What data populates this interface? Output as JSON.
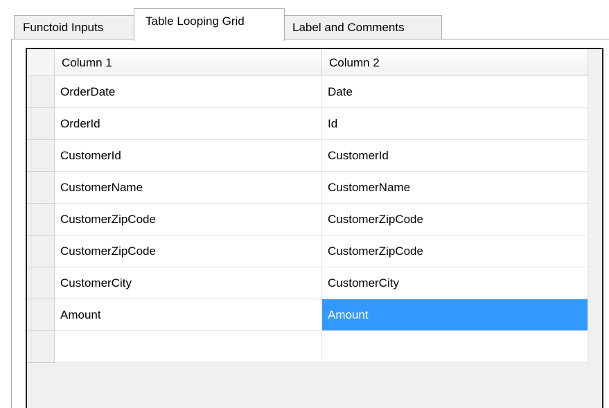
{
  "tabs": [
    {
      "label": "Functoid Inputs",
      "selected": false
    },
    {
      "label": "Table Looping Grid",
      "selected": true
    },
    {
      "label": "Label and Comments",
      "selected": false
    }
  ],
  "grid": {
    "columns": [
      "Column 1",
      "Column 2"
    ],
    "rows": [
      [
        "OrderDate",
        "Date"
      ],
      [
        "OrderId",
        "Id"
      ],
      [
        "CustomerId",
        "CustomerId"
      ],
      [
        "CustomerName",
        "CustomerName"
      ],
      [
        "CustomerZipCode",
        "CustomerZipCode"
      ],
      [
        "CustomerZipCode",
        "CustomerZipCode"
      ],
      [
        "CustomerCity",
        "CustomerCity"
      ],
      [
        "Amount",
        "Amount"
      ],
      [
        "",
        ""
      ]
    ],
    "selected_cell": {
      "row": 7,
      "column": 1
    }
  },
  "colors": {
    "selection": "#3399ff",
    "selection_text": "#ffffff",
    "tab_background": "#f0f0f0",
    "grid_background": "#f0f0f0"
  }
}
